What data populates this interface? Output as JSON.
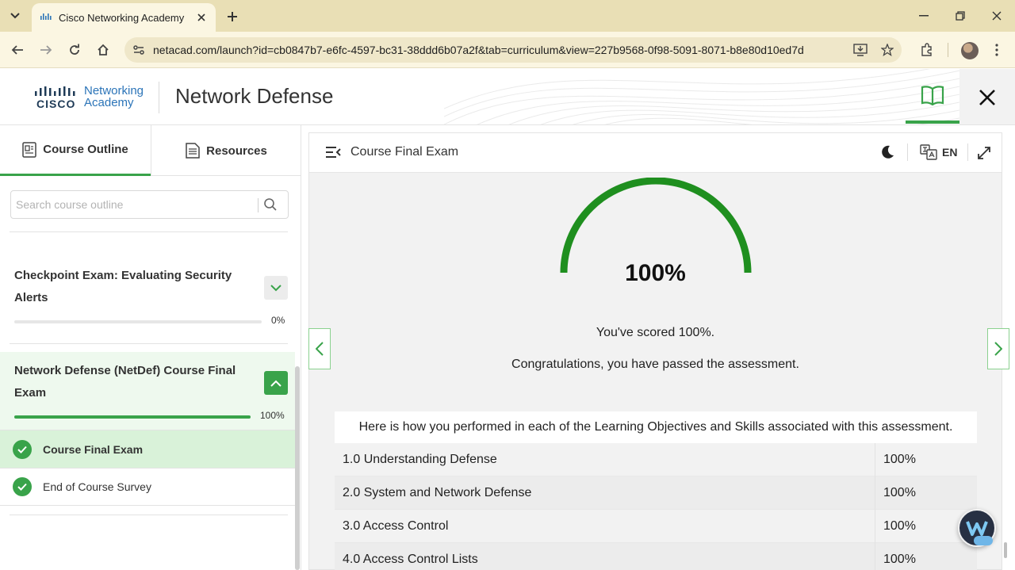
{
  "browser": {
    "tab_title": "Cisco Networking Academy",
    "url": "netacad.com/launch?id=cb0847b7-e6fc-4597-bc31-38ddd6b07a2f&tab=curriculum&view=227b9568-0f98-5091-8071-b8e80d10ed7d"
  },
  "header": {
    "logo_cisco": "CISCO",
    "logo_line1": "Networking",
    "logo_line2": "Academy",
    "course_title": "Network Defense"
  },
  "sidebar": {
    "tabs": [
      {
        "label": "Course Outline",
        "active": true,
        "icon": "outline-icon"
      },
      {
        "label": "Resources",
        "active": false,
        "icon": "document-icon"
      }
    ],
    "search_placeholder": "Search course outline",
    "sections": [
      {
        "title": "Checkpoint Exam: Evaluating Security Alerts",
        "progress_percent": 0,
        "progress_label": "0%",
        "expanded": false
      },
      {
        "title": "Network Defense (NetDef) Course Final Exam",
        "progress_percent": 100,
        "progress_label": "100%",
        "expanded": true,
        "items": [
          {
            "label": "Course Final Exam",
            "completed": true,
            "selected": true
          },
          {
            "label": "End of Course Survey",
            "completed": true,
            "selected": false
          }
        ]
      }
    ]
  },
  "main": {
    "title": "Course Final Exam",
    "language": "EN",
    "score_percent": 100,
    "score_label": "100%",
    "score_text": "You've scored 100%.",
    "congrats_text": "Congratulations, you have passed the assessment.",
    "table_header": "Here is how you performed in each of the Learning Objectives and Skills associated with this assessment.",
    "objectives": [
      {
        "name": "1.0 Understanding Defense",
        "score": "100%"
      },
      {
        "name": "2.0 System and Network Defense",
        "score": "100%"
      },
      {
        "name": "3.0 Access Control",
        "score": "100%"
      },
      {
        "name": "4.0 Access Control Lists",
        "score": "100%"
      }
    ]
  },
  "colors": {
    "accent_green": "#39a34a",
    "gauge_green": "#1f8f1f",
    "tab_bar": "#e9dfb5"
  }
}
